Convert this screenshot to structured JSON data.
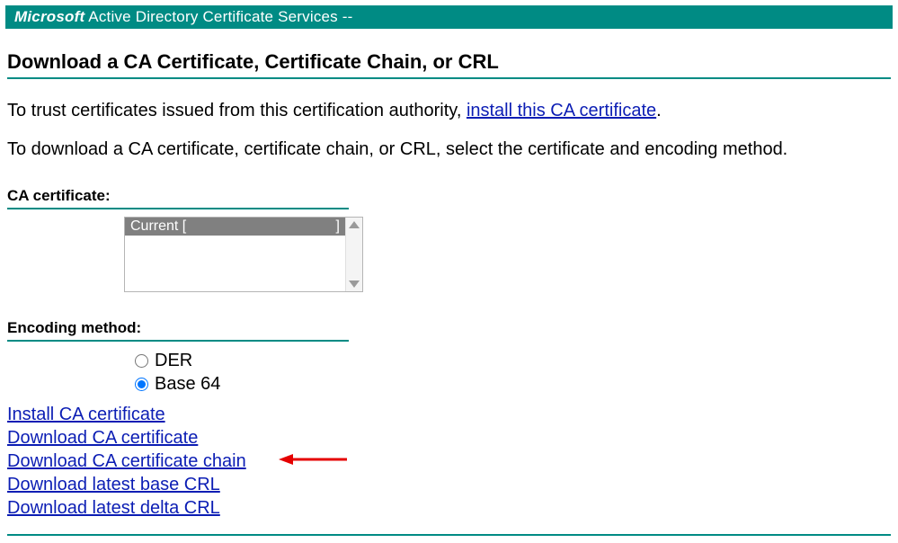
{
  "header": {
    "brand": "Microsoft",
    "product": " Active Directory Certificate Services  --"
  },
  "title": "Download a CA Certificate, Certificate Chain, or CRL",
  "intro": {
    "prefix": "To trust certificates issued from this certification authority, ",
    "link": "install this CA certificate",
    "suffix": "."
  },
  "instructions": "To download a CA certificate, certificate chain, or CRL, select the certificate and encoding method.",
  "ca_label": "CA certificate:",
  "listbox": {
    "item_left": "Current [",
    "item_right": "]"
  },
  "encoding_label": "Encoding method:",
  "radios": {
    "der": "DER",
    "base64": "Base 64"
  },
  "links": {
    "install": "Install CA certificate",
    "download_cert": "Download CA certificate",
    "download_chain": "Download CA certificate chain",
    "download_base_crl": "Download latest base CRL",
    "download_delta_crl": "Download latest delta CRL"
  }
}
